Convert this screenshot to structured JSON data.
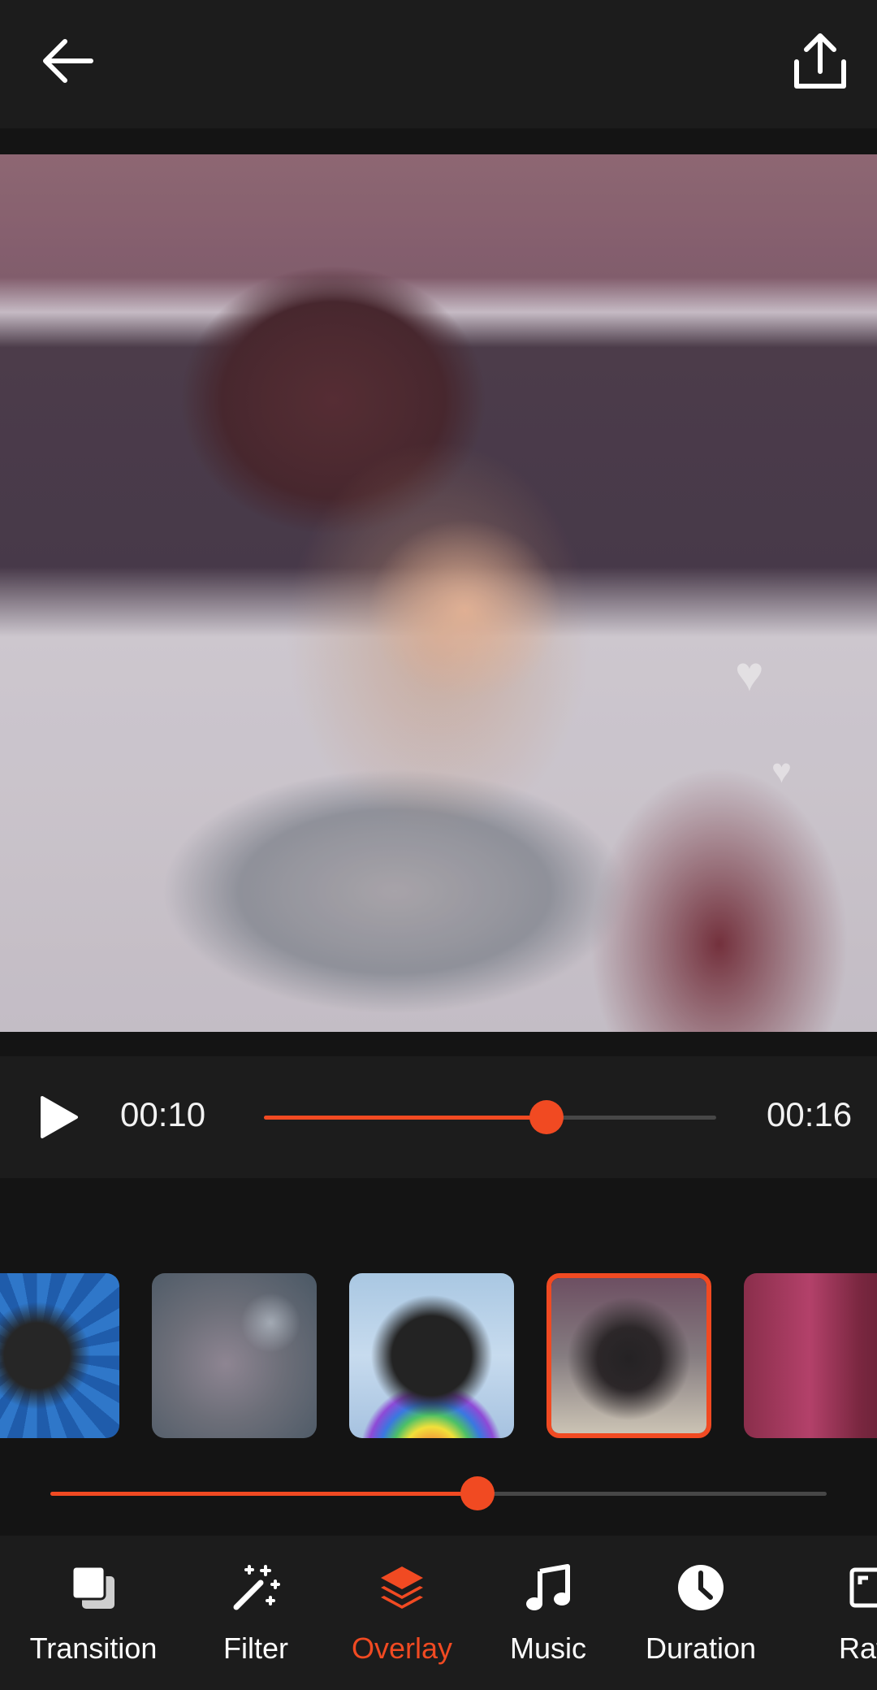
{
  "toolbar": {
    "back_icon": "arrow-left-icon",
    "share_icon": "share-upload-icon"
  },
  "player": {
    "current_time": "00:10",
    "total_time": "00:16",
    "progress": 0.625,
    "play_icon": "play-icon"
  },
  "overlays": {
    "selected_index": 3,
    "items": [
      {
        "name": "blue-rays-overlay"
      },
      {
        "name": "soft-blur-moon-overlay"
      },
      {
        "name": "rainbow-clouds-overlay"
      },
      {
        "name": "pink-snow-overlay"
      },
      {
        "name": "hearts-pink-overlay"
      }
    ],
    "intensity": 0.55
  },
  "colors": {
    "accent": "#f14a22",
    "background": "#141414",
    "bar": "#1c1c1c"
  },
  "nav": {
    "items": [
      {
        "label": "Transition",
        "icon": "transition-icon"
      },
      {
        "label": "Filter",
        "icon": "magic-wand-icon"
      },
      {
        "label": "Overlay",
        "icon": "layers-icon",
        "active": true
      },
      {
        "label": "Music",
        "icon": "music-note-icon"
      },
      {
        "label": "Duration",
        "icon": "clock-icon"
      },
      {
        "label": "Ratio",
        "icon": "aspect-ratio-icon"
      }
    ]
  }
}
